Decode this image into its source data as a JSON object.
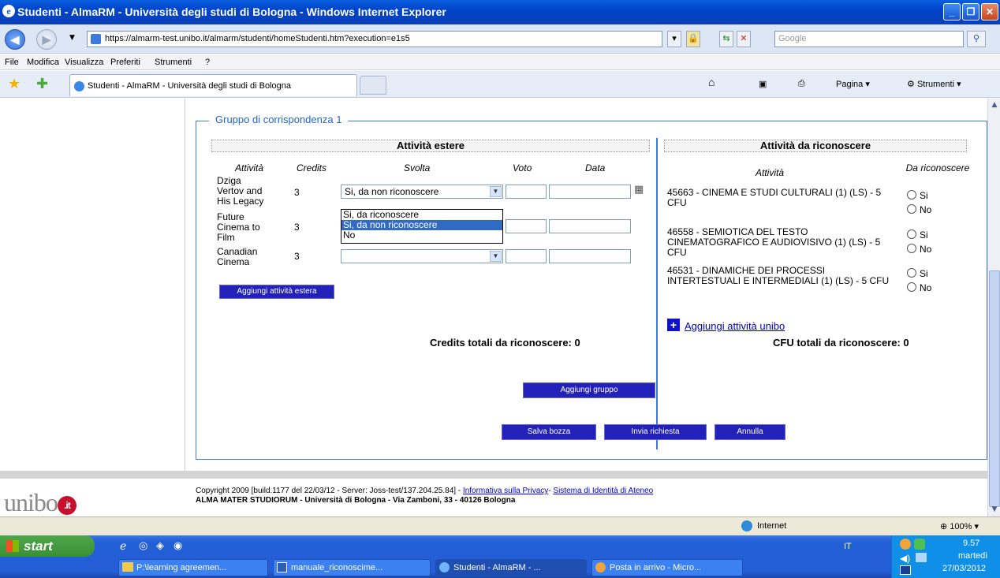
{
  "window": {
    "title": "Studenti - AlmaRM - Università degli studi di Bologna - Windows Internet Explorer",
    "url": "https://almarm-test.unibo.it/almarm/studenti/homeStudenti.htm?execution=e1s5",
    "search_placeholder": "Google",
    "menu": [
      "File",
      "Modifica",
      "Visualizza",
      "Preferiti",
      "Strumenti",
      "?"
    ],
    "tab_title": "Studenti - AlmaRM - Università degli studi di Bologna",
    "toolbar_page": "Pagina",
    "toolbar_tools": "Strumenti"
  },
  "group": {
    "legend": "Gruppo di corrispondenza 1",
    "foreign_header": "Attività estere",
    "recognize_header": "Attività da riconoscere",
    "col_attivita": "Attività",
    "col_credits": "Credits",
    "col_svolta": "Svolta",
    "col_voto": "Voto",
    "col_data": "Data",
    "col_attivita_right": "Attività",
    "col_da_riconoscere": "Da riconoscere",
    "foreign_rows": [
      {
        "name": "Dziga Vertov and His Legacy",
        "credits": "3",
        "svolta": "Si, da non riconoscere"
      },
      {
        "name": "Future Cinema to Film",
        "credits": "3",
        "svolta": ""
      },
      {
        "name": "Canadian Cinema",
        "credits": "3",
        "svolta": ""
      }
    ],
    "dropdown_options": [
      "",
      "Si, da riconoscere",
      "Si, da non riconoscere",
      "No"
    ],
    "add_foreign_button": "Aggiungi attività estera",
    "credits_total": "Credits totali da riconoscere: 0",
    "unibo_rows": [
      {
        "name": "45663 - CINEMA E STUDI CULTURALI (1) (LS) - 5 CFU",
        "yes": "Si",
        "no": "No"
      },
      {
        "name": "46558 - SEMIOTICA DEL TESTO CINEMATOGRAFICO E AUDIOVISIVO (1) (LS) - 5 CFU",
        "yes": "Si",
        "no": "No"
      },
      {
        "name": "46531 - DINAMICHE DEI PROCESSI INTERTESTUALI E INTERMEDIALI (1) (LS) - 5 CFU",
        "yes": "Si",
        "no": "No"
      }
    ],
    "add_unibo_link": "Aggiungi attività unibo",
    "cfu_total": "CFU totali da riconoscere: 0"
  },
  "actions": {
    "add_group": "Aggiungi gruppo",
    "save_draft": "Salva bozza",
    "send_request": "Invia richiesta",
    "cancel": "Annulla"
  },
  "footer": {
    "logo_text": "unibo",
    "logo_badge": ".it",
    "copyright": "Copyright 2009 [build.1177 del 22/03/12 - Server: Joss-test/137.204.25.84] - ",
    "privacy_link": "Informativa sulla Privacy",
    "identity_link": "Sistema di Identità di Ateneo",
    "address": "ALMA MATER STUDIORUM - Università di Bologna - Via Zamboni, 33 - 40126 Bologna"
  },
  "status": {
    "zone": "Internet",
    "zoom": "100%"
  },
  "taskbar": {
    "start": "start",
    "items": [
      "P:\\learning agreemen...",
      "manuale_riconoscime...",
      "Studenti - AlmaRM - ...",
      "Posta in arrivo - Micro..."
    ],
    "lang": "IT",
    "time": "9.57",
    "day": "martedì",
    "date": "27/03/2012"
  }
}
